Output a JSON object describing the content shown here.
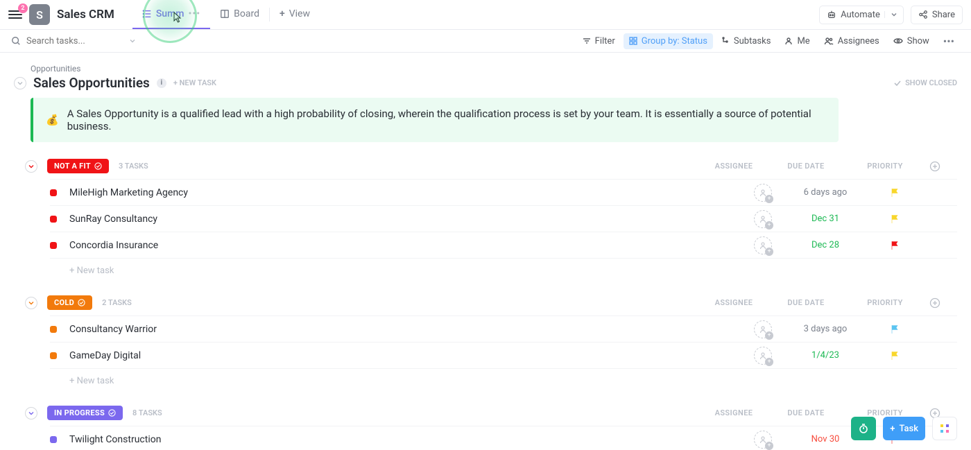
{
  "header": {
    "badge_count": "2",
    "space_letter": "S",
    "space_title": "Sales CRM",
    "tabs": [
      {
        "label": "Summ",
        "icon": "list-icon"
      },
      {
        "label": "Board",
        "icon": "board-icon"
      },
      {
        "label": "View",
        "icon": "plus-icon"
      }
    ],
    "automate": "Automate",
    "share": "Share"
  },
  "toolbar": {
    "search_placeholder": "Search tasks...",
    "filter": "Filter",
    "group_by": "Group by: Status",
    "subtasks": "Subtasks",
    "me": "Me",
    "assignees": "Assignees",
    "show": "Show"
  },
  "section": {
    "breadcrumb": "Opportunities",
    "title": "Sales Opportunities",
    "new_task": "+ NEW TASK",
    "show_closed": "SHOW CLOSED",
    "description_emoji": "💰",
    "description": "A Sales Opportunity is a qualified lead with a high probability of closing, wherein the qualification process is set by your team. It is essentially a source of potential business."
  },
  "columns": {
    "assignee": "ASSIGNEE",
    "due_date": "DUE DATE",
    "priority": "PRIORITY"
  },
  "new_task_row": "+ New task",
  "groups": [
    {
      "status": "NOT A FIT",
      "color": "#f01316",
      "task_count_label": "3 TASKS",
      "tasks": [
        {
          "name": "MileHigh Marketing Agency",
          "due": "6 days ago",
          "due_style": "gray",
          "flag": "#f8d62b"
        },
        {
          "name": "SunRay Consultancy",
          "due": "Dec 31",
          "due_style": "green",
          "flag": "#f8d62b"
        },
        {
          "name": "Concordia Insurance",
          "due": "Dec 28",
          "due_style": "green",
          "flag": "#f01316"
        }
      ]
    },
    {
      "status": "COLD",
      "color": "#f27a0c",
      "task_count_label": "2 TASKS",
      "tasks": [
        {
          "name": "Consultancy Warrior",
          "due": "3 days ago",
          "due_style": "gray",
          "flag": "#5bc4f1"
        },
        {
          "name": "GameDay Digital",
          "due": "1/4/23",
          "due_style": "green",
          "flag": "#f8d62b"
        }
      ]
    },
    {
      "status": "IN PROGRESS",
      "color": "#7b68ee",
      "task_count_label": "8 TASKS",
      "tasks": [
        {
          "name": "Twilight Construction",
          "due": "Nov 30",
          "due_style": "red",
          "flag": "#f01316"
        }
      ]
    }
  ],
  "float": {
    "task_label": "Task"
  }
}
